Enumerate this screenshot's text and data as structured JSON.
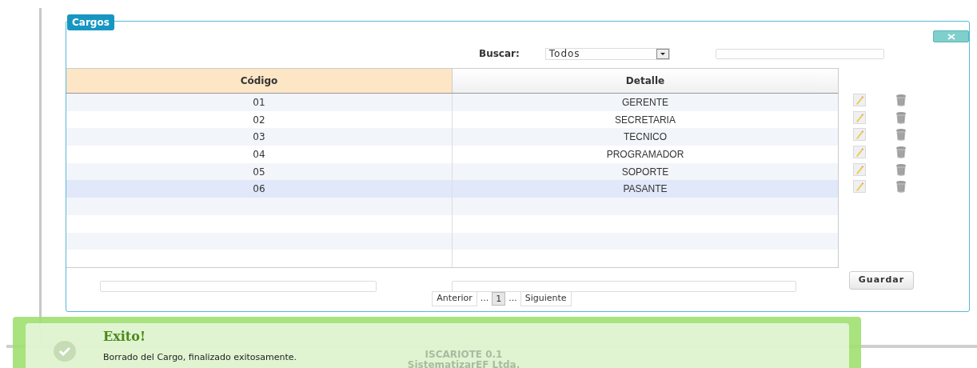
{
  "panel": {
    "title": "Cargos"
  },
  "search": {
    "label": "Buscar:",
    "filter": "Todos"
  },
  "table": {
    "columns": [
      "Código",
      "Detalle"
    ],
    "rows": [
      {
        "code": "01",
        "detail": "GERENTE",
        "selected": false
      },
      {
        "code": "02",
        "detail": "SECRETARIA",
        "selected": false
      },
      {
        "code": "03",
        "detail": "TECNICO",
        "selected": false
      },
      {
        "code": "04",
        "detail": "PROGRAMADOR",
        "selected": false
      },
      {
        "code": "05",
        "detail": "SOPORTE",
        "selected": false
      },
      {
        "code": "06",
        "detail": "PASANTE",
        "selected": true
      }
    ]
  },
  "save_button": "Guardar",
  "pagination": [
    {
      "label": "Anterior",
      "kind": "button"
    },
    {
      "label": "...",
      "kind": "gap"
    },
    {
      "label": "1",
      "kind": "page"
    },
    {
      "label": "...",
      "kind": "gap"
    },
    {
      "label": "Siguiente",
      "kind": "button"
    }
  ],
  "footer": [
    "ISCARIOTE 0.1",
    "SistematizarEF Ltda."
  ],
  "notification": {
    "title": "Exito!",
    "message": "Borrado del Cargo, finalizado exitosamente."
  }
}
